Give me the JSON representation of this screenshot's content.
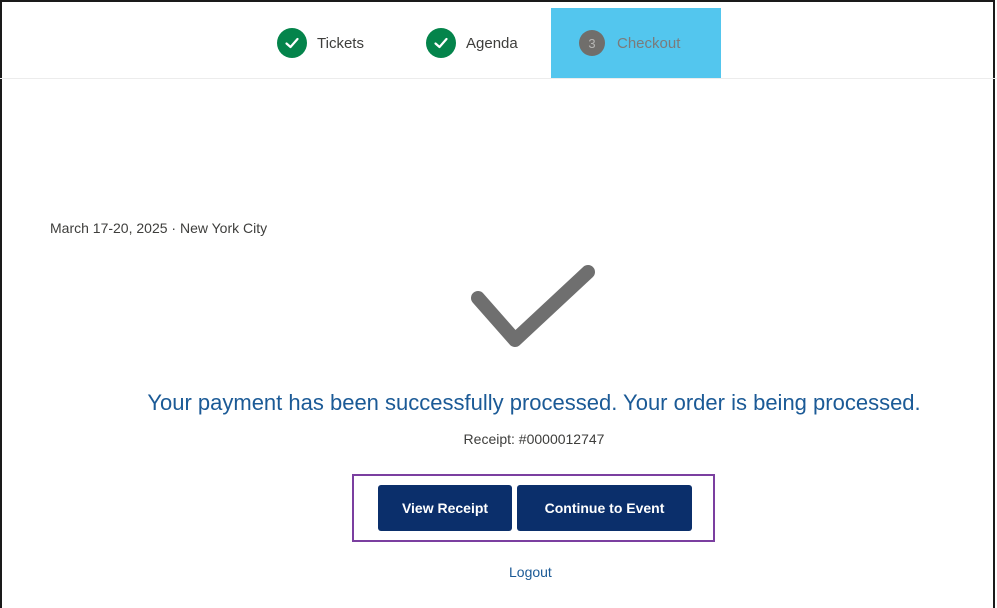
{
  "stepper": {
    "steps": [
      {
        "label": "Tickets",
        "status": "complete"
      },
      {
        "label": "Agenda",
        "status": "complete"
      },
      {
        "label": "Checkout",
        "number": "3",
        "status": "active"
      }
    ]
  },
  "event": {
    "meta": "March 17-20, 2025 · New York City"
  },
  "confirmation": {
    "icon": "checkmark-icon",
    "message": "Your payment has been successfully processed. Your order is being processed.",
    "receipt": "Receipt: #0000012747"
  },
  "actions": {
    "view_receipt": "View Receipt",
    "continue_to_event": "Continue to Event",
    "logout": "Logout"
  },
  "colors": {
    "complete": "#04844b",
    "active_step": "#53c6ee",
    "primary_button": "#0b2f6b",
    "link": "#1b5a96",
    "highlight_border": "#7b3fa0"
  }
}
